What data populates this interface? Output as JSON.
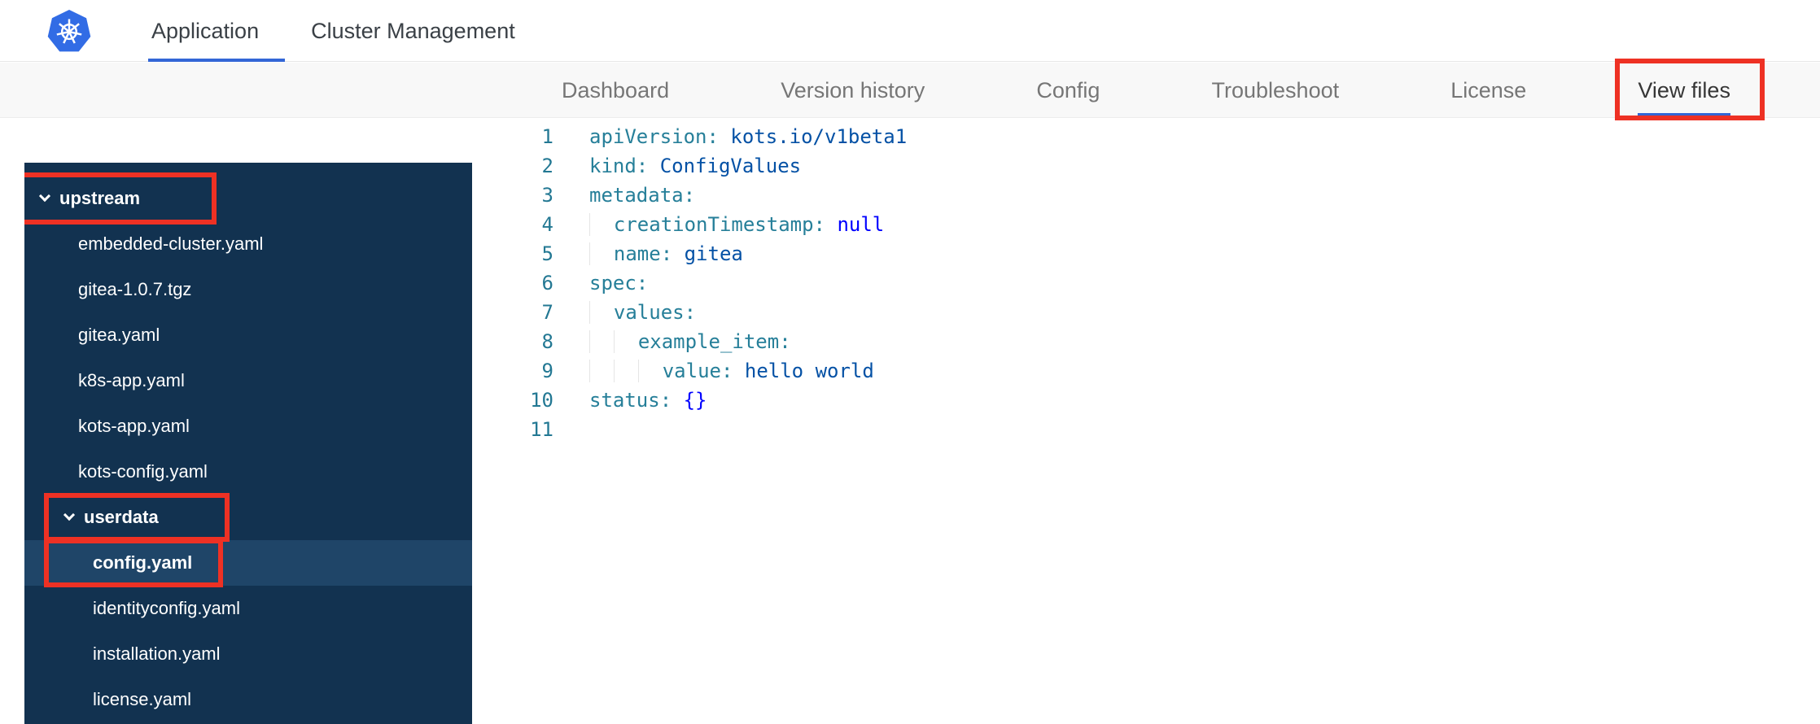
{
  "header": {
    "tabs": [
      {
        "id": "application",
        "label": "Application",
        "active": true
      },
      {
        "id": "cluster-management",
        "label": "Cluster Management",
        "active": false
      }
    ]
  },
  "subnav": {
    "items": [
      {
        "id": "dashboard",
        "label": "Dashboard",
        "active": false,
        "annotated": false
      },
      {
        "id": "version-history",
        "label": "Version history",
        "active": false,
        "annotated": false
      },
      {
        "id": "config",
        "label": "Config",
        "active": false,
        "annotated": false
      },
      {
        "id": "troubleshoot",
        "label": "Troubleshoot",
        "active": false,
        "annotated": false
      },
      {
        "id": "license",
        "label": "License",
        "active": false,
        "annotated": false
      },
      {
        "id": "view-files",
        "label": "View files",
        "active": true,
        "annotated": true
      }
    ]
  },
  "file_tree": {
    "items": [
      {
        "id": "upstream",
        "label": "upstream",
        "type": "folder",
        "expanded": true,
        "indent": 0,
        "annotated": true,
        "selected": false
      },
      {
        "id": "embedded-cluster-yaml",
        "label": "embedded-cluster.yaml",
        "type": "file",
        "indent": 1,
        "annotated": false,
        "selected": false
      },
      {
        "id": "gitea-1-0-7-tgz",
        "label": "gitea-1.0.7.tgz",
        "type": "file",
        "indent": 1,
        "annotated": false,
        "selected": false
      },
      {
        "id": "gitea-yaml",
        "label": "gitea.yaml",
        "type": "file",
        "indent": 1,
        "annotated": false,
        "selected": false
      },
      {
        "id": "k8s-app-yaml",
        "label": "k8s-app.yaml",
        "type": "file",
        "indent": 1,
        "annotated": false,
        "selected": false
      },
      {
        "id": "kots-app-yaml",
        "label": "kots-app.yaml",
        "type": "file",
        "indent": 1,
        "annotated": false,
        "selected": false
      },
      {
        "id": "kots-config-yaml",
        "label": "kots-config.yaml",
        "type": "file",
        "indent": 1,
        "annotated": false,
        "selected": false
      },
      {
        "id": "userdata",
        "label": "userdata",
        "type": "folder",
        "expanded": true,
        "indent": 1,
        "annotated": true,
        "selected": false
      },
      {
        "id": "config-yaml",
        "label": "config.yaml",
        "type": "file",
        "indent": 2,
        "annotated": true,
        "selected": true
      },
      {
        "id": "identityconfig-yaml",
        "label": "identityconfig.yaml",
        "type": "file",
        "indent": 2,
        "annotated": false,
        "selected": false
      },
      {
        "id": "installation-yaml",
        "label": "installation.yaml",
        "type": "file",
        "indent": 2,
        "annotated": false,
        "selected": false
      },
      {
        "id": "license-yaml",
        "label": "license.yaml",
        "type": "file",
        "indent": 2,
        "annotated": false,
        "selected": false
      }
    ]
  },
  "editor": {
    "language": "yaml",
    "lines": [
      {
        "num": "1",
        "tokens": [
          {
            "t": "key",
            "v": "apiVersion:"
          },
          {
            "t": "plain",
            "v": " "
          },
          {
            "t": "str",
            "v": "kots.io/v1beta1"
          }
        ]
      },
      {
        "num": "2",
        "tokens": [
          {
            "t": "key",
            "v": "kind:"
          },
          {
            "t": "plain",
            "v": " "
          },
          {
            "t": "str",
            "v": "ConfigValues"
          }
        ]
      },
      {
        "num": "3",
        "tokens": [
          {
            "t": "key",
            "v": "metadata:"
          }
        ]
      },
      {
        "num": "4",
        "tokens": [
          {
            "t": "ind",
            "v": "  "
          },
          {
            "t": "key",
            "v": "creationTimestamp:"
          },
          {
            "t": "plain",
            "v": " "
          },
          {
            "t": "kw",
            "v": "null"
          }
        ]
      },
      {
        "num": "5",
        "tokens": [
          {
            "t": "ind",
            "v": "  "
          },
          {
            "t": "key",
            "v": "name:"
          },
          {
            "t": "plain",
            "v": " "
          },
          {
            "t": "str",
            "v": "gitea"
          }
        ]
      },
      {
        "num": "6",
        "tokens": [
          {
            "t": "key",
            "v": "spec:"
          }
        ]
      },
      {
        "num": "7",
        "tokens": [
          {
            "t": "ind",
            "v": "  "
          },
          {
            "t": "key",
            "v": "values:"
          }
        ]
      },
      {
        "num": "8",
        "tokens": [
          {
            "t": "ind",
            "v": "  "
          },
          {
            "t": "ind",
            "v": "  "
          },
          {
            "t": "key",
            "v": "example_item:"
          }
        ]
      },
      {
        "num": "9",
        "tokens": [
          {
            "t": "ind",
            "v": "  "
          },
          {
            "t": "ind",
            "v": "  "
          },
          {
            "t": "ind",
            "v": "  "
          },
          {
            "t": "key",
            "v": "value:"
          },
          {
            "t": "plain",
            "v": " "
          },
          {
            "t": "str",
            "v": "hello world"
          }
        ]
      },
      {
        "num": "10",
        "tokens": [
          {
            "t": "key",
            "v": "status:"
          },
          {
            "t": "plain",
            "v": " "
          },
          {
            "t": "kw",
            "v": "{}"
          }
        ]
      },
      {
        "num": "11",
        "tokens": []
      }
    ]
  },
  "colors": {
    "accent_blue": "#3366d6",
    "annotation_red": "#ee3124",
    "sidebar_bg": "#123250",
    "sidebar_selected_bg": "#1f4568",
    "code_key": "#267f99",
    "code_string": "#0451a5",
    "code_keyword": "#0000ff",
    "line_number": "#237893",
    "kubernetes_blue": "#326ce5"
  },
  "icons": {
    "logo": "kubernetes-logo",
    "folder_toggle": "chevron-down-icon"
  }
}
